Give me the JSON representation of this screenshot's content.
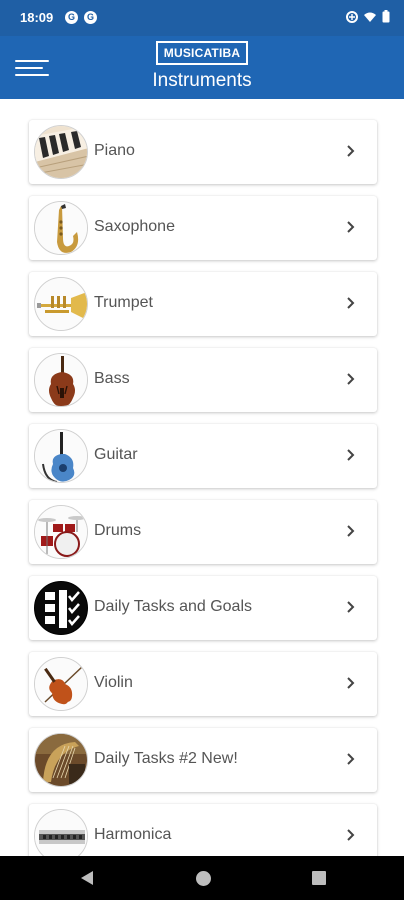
{
  "status_bar": {
    "time": "18:09",
    "app_icon_1": "G",
    "app_icon_2": "G"
  },
  "header": {
    "logo": "MUSICATIBA",
    "title": "Instruments"
  },
  "items": [
    {
      "label": "Piano"
    },
    {
      "label": "Saxophone"
    },
    {
      "label": "Trumpet"
    },
    {
      "label": "Bass"
    },
    {
      "label": "Guitar"
    },
    {
      "label": "Drums"
    },
    {
      "label": "Daily Tasks and Goals"
    },
    {
      "label": "Violin"
    },
    {
      "label": "Daily Tasks #2 New!"
    },
    {
      "label": "Harmonica"
    }
  ],
  "colors": {
    "header": "#1f66b4",
    "status_bar": "#1f5fa5",
    "card_text": "#555555",
    "nav_bar": "#000000"
  }
}
